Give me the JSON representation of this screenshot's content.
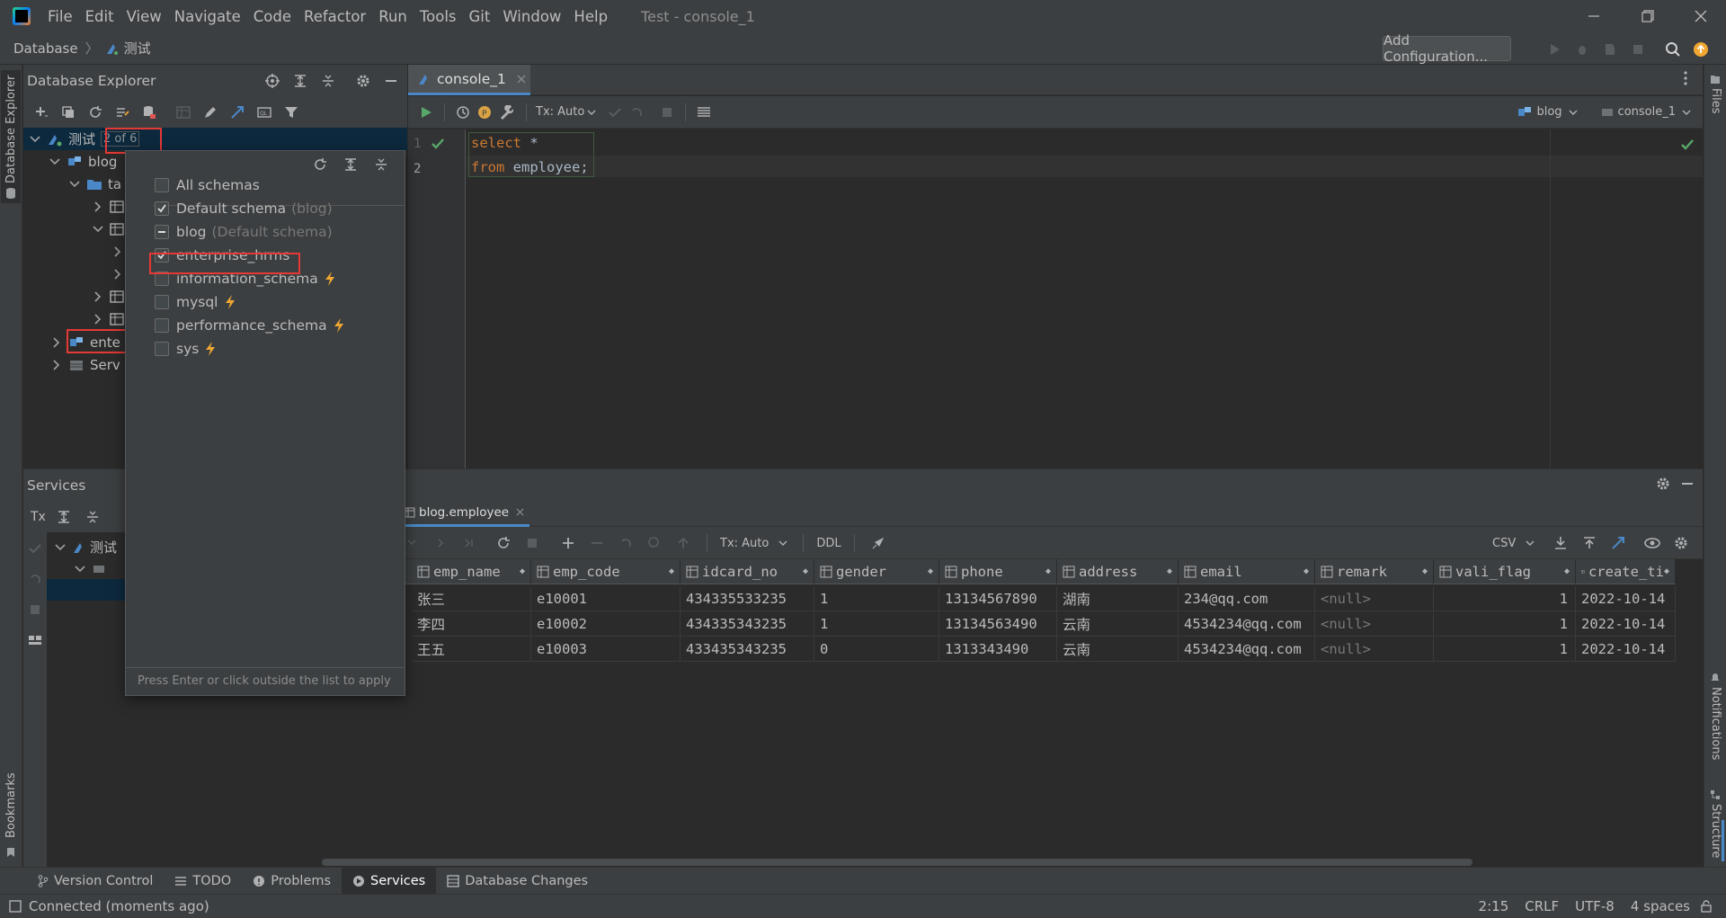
{
  "window": {
    "title": "Test - console_1",
    "menu": [
      "File",
      "Edit",
      "View",
      "Navigate",
      "Code",
      "Refactor",
      "Run",
      "Tools",
      "Git",
      "Window",
      "Help"
    ]
  },
  "nav": {
    "breadcrumb_root": "Database",
    "breadcrumb_current": "测试",
    "add_configuration": "Add Configuration..."
  },
  "left_strip": {
    "database_explorer": "Database Explorer",
    "bookmarks": "Bookmarks"
  },
  "right_strip": {
    "files": "Files",
    "notifications": "Notifications",
    "structure": "Structure"
  },
  "db_explorer": {
    "title": "Database Explorer",
    "tree": {
      "root_label": "测试",
      "root_badge": "2 of 6",
      "blog": "blog",
      "tables_folder": "ta",
      "enterprise_partial": "ente",
      "server_partial": "Serv"
    }
  },
  "services": {
    "title": "Services",
    "tx_label": "Tx",
    "node_label": "测试"
  },
  "schema_popup": {
    "items": [
      {
        "label": "All schemas",
        "suffix": "",
        "state": "unchecked",
        "bolt": false
      },
      {
        "label": "Default schema",
        "suffix": "(blog)",
        "state": "checked",
        "bolt": false
      },
      {
        "label": "blog",
        "suffix": "(Default schema)",
        "state": "partial",
        "bolt": false
      },
      {
        "label": "enterprise_hrms",
        "suffix": "",
        "state": "checked",
        "bolt": false
      },
      {
        "label": "information_schema",
        "suffix": "",
        "state": "unchecked",
        "bolt": true
      },
      {
        "label": "mysql",
        "suffix": "",
        "state": "unchecked",
        "bolt": true
      },
      {
        "label": "performance_schema",
        "suffix": "",
        "state": "unchecked",
        "bolt": true
      },
      {
        "label": "sys",
        "suffix": "",
        "state": "unchecked",
        "bolt": true
      }
    ],
    "hint": "Press Enter or click outside the list to apply"
  },
  "editor": {
    "tab_label": "console_1",
    "tx_mode": "Tx: Auto",
    "schema_selector": "blog",
    "session_selector": "console_1",
    "lines": [
      {
        "num": "1",
        "kw": "select",
        "rest": " *"
      },
      {
        "num": "2",
        "kw": "from",
        "rest": " employee;"
      }
    ]
  },
  "results": {
    "tab_label": "blog.employee",
    "tx_mode": "Tx: Auto",
    "ddl": "DDL",
    "export_format": "CSV",
    "columns": [
      "emp_name",
      "emp_code",
      "idcard_no",
      "gender",
      "phone",
      "address",
      "email",
      "remark",
      "vali_flag",
      "create_ti"
    ],
    "rows": [
      [
        "张三",
        "e10001",
        "434335533235",
        "1",
        "13134567890",
        "湖南",
        "234@qq.com",
        "<null>",
        "1",
        "2022-10-14"
      ],
      [
        "李四",
        "e10002",
        "434335343235",
        "1",
        "13134563490",
        "云南",
        "4534234@qq.com",
        "<null>",
        "1",
        "2022-10-14"
      ],
      [
        "王五",
        "e10003",
        "433435343235",
        "0",
        "1313343490",
        "云南",
        "4534234@qq.com",
        "<null>",
        "1",
        "2022-10-14"
      ]
    ]
  },
  "bottom_tabs": [
    "Version Control",
    "TODO",
    "Problems",
    "Services",
    "Database Changes"
  ],
  "status": {
    "message": "Connected (moments ago)",
    "position": "2:15",
    "line_sep": "CRLF",
    "encoding": "UTF-8",
    "indent": "4 spaces"
  },
  "colors": {
    "accent": "#4a88c7",
    "highlight_box": "#e53935",
    "bolt": "#f0a732",
    "keyword": "#cc7832",
    "run_green": "#59a869"
  }
}
